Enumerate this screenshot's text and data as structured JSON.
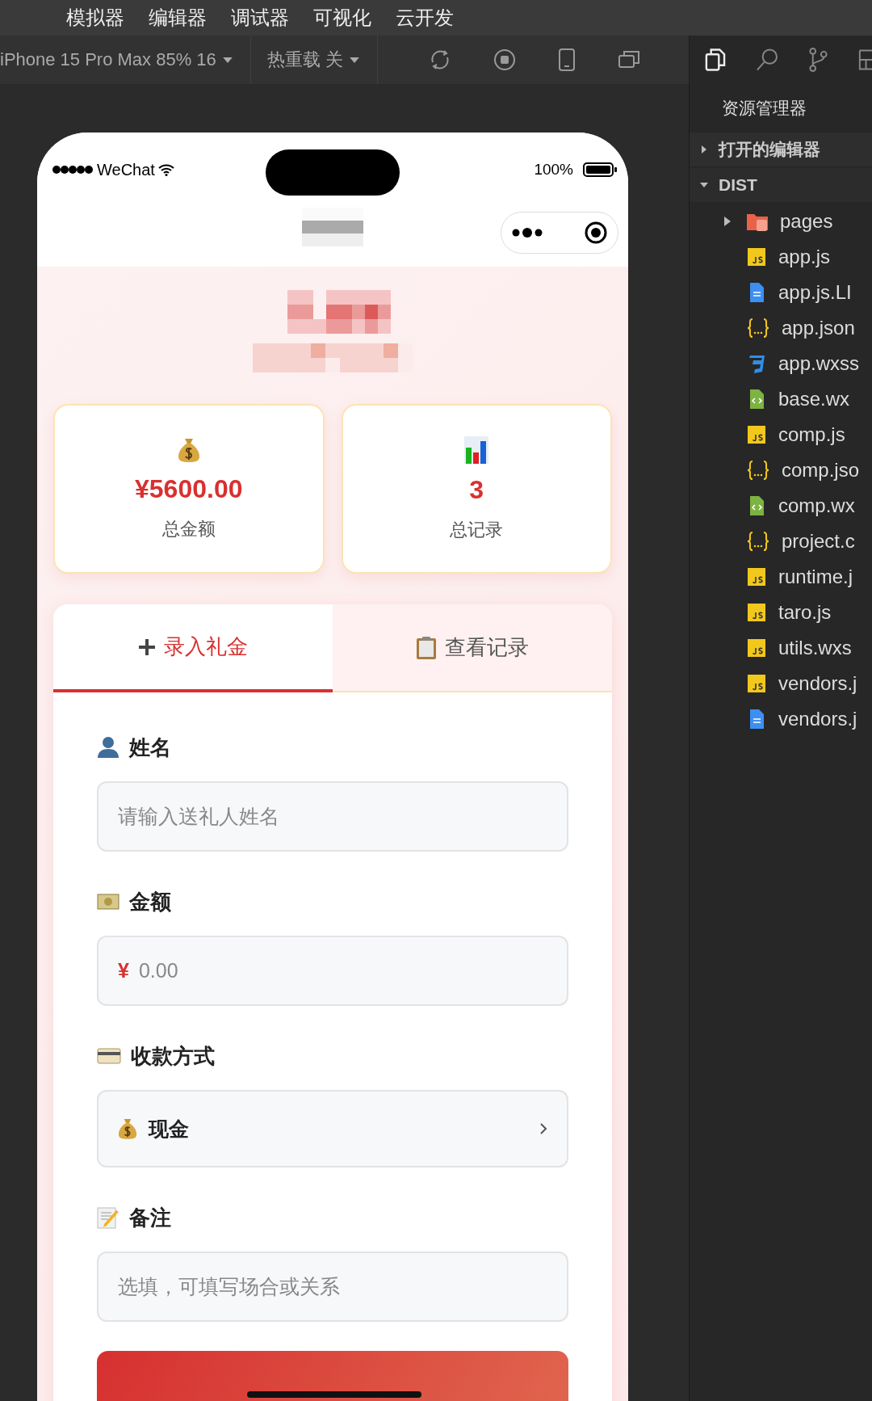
{
  "menu": [
    "模拟器",
    "编辑器",
    "调试器",
    "可视化",
    "云开发"
  ],
  "toolbar": {
    "device": "iPhone 15 Pro Max 85% 16",
    "hot_reload": "热重载 关"
  },
  "phone": {
    "status": {
      "carrier": "WeChat",
      "battery": "100%"
    },
    "stats": [
      {
        "kind": "money",
        "value": "¥5600.00",
        "label": "总金额"
      },
      {
        "kind": "chart",
        "value": "3",
        "label": "总记录"
      }
    ],
    "tabs": [
      {
        "kind": "add",
        "label": "录入礼金",
        "selected": true
      },
      {
        "kind": "clipboard",
        "label": "查看记录",
        "selected": false
      }
    ],
    "fields": [
      {
        "kind": "name",
        "label": "姓名",
        "placeholder": "请输入送礼人姓名"
      },
      {
        "kind": "amount",
        "label": "金额",
        "currency": "¥",
        "placeholder": "0.00"
      },
      {
        "kind": "method",
        "label": "收款方式",
        "value": "现金"
      },
      {
        "kind": "note",
        "label": "备注",
        "placeholder": "选填，可填写场合或关系"
      }
    ]
  },
  "sidebar": {
    "title": "资源管理器",
    "sections": [
      {
        "label": "打开的编辑器",
        "expanded": false
      },
      {
        "label": "DIST",
        "expanded": true,
        "children": [
          {
            "kind": "folder",
            "name": "pages",
            "expanded": false
          },
          {
            "kind": "js",
            "name": "app.js"
          },
          {
            "kind": "doc",
            "name": "app.js.LI"
          },
          {
            "kind": "json",
            "name": "app.json"
          },
          {
            "kind": "css",
            "name": "app.wxss"
          },
          {
            "kind": "wxml",
            "name": "base.wx"
          },
          {
            "kind": "js",
            "name": "comp.js"
          },
          {
            "kind": "json",
            "name": "comp.jso"
          },
          {
            "kind": "wxml",
            "name": "comp.wx"
          },
          {
            "kind": "json",
            "name": "project.c"
          },
          {
            "kind": "js",
            "name": "runtime.j"
          },
          {
            "kind": "js",
            "name": "taro.js"
          },
          {
            "kind": "js",
            "name": "utils.wxs"
          },
          {
            "kind": "js",
            "name": "vendors.j"
          },
          {
            "kind": "doc",
            "name": "vendors.j"
          }
        ]
      }
    ]
  }
}
